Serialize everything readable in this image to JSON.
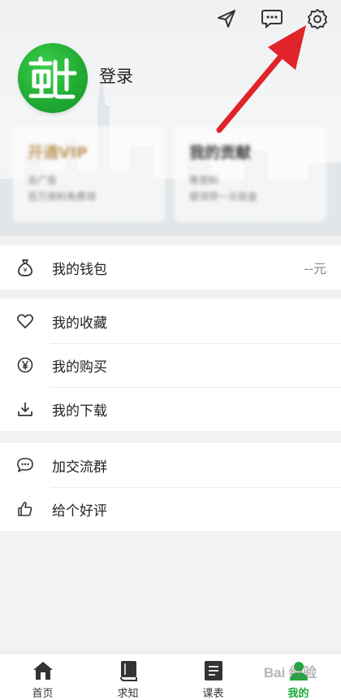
{
  "header": {
    "login_label": "登录",
    "avatar_glyph": "知",
    "icons": [
      "send-icon",
      "message-icon",
      "settings-icon"
    ]
  },
  "cards": [
    {
      "title": "开通VIP",
      "lines": [
        "去广告",
        "百万资料免费领"
      ]
    },
    {
      "title": "我的贡献",
      "lines": [
        "等资料",
        "提领劳一元现金"
      ]
    }
  ],
  "wallet": {
    "label": "我的钱包",
    "value": "--元"
  },
  "list_group_1": [
    {
      "label": "我的收藏",
      "icon": "heart-icon"
    },
    {
      "label": "我的购买",
      "icon": "yen-icon"
    },
    {
      "label": "我的下载",
      "icon": "download-icon"
    }
  ],
  "list_group_2": [
    {
      "label": "加交流群",
      "icon": "chat-bubble-icon"
    },
    {
      "label": "给个好评",
      "icon": "thumbs-up-icon"
    }
  ],
  "tabs": [
    {
      "label": "首页",
      "icon": "home-icon"
    },
    {
      "label": "求知",
      "icon": "book-icon"
    },
    {
      "label": "课表",
      "icon": "schedule-icon"
    },
    {
      "label": "我的",
      "icon": "profile-icon",
      "active": true
    }
  ],
  "watermark": "Bai 经验",
  "colors": {
    "accent_green": "#1aaa3a",
    "arrow_red": "#e0242a"
  }
}
